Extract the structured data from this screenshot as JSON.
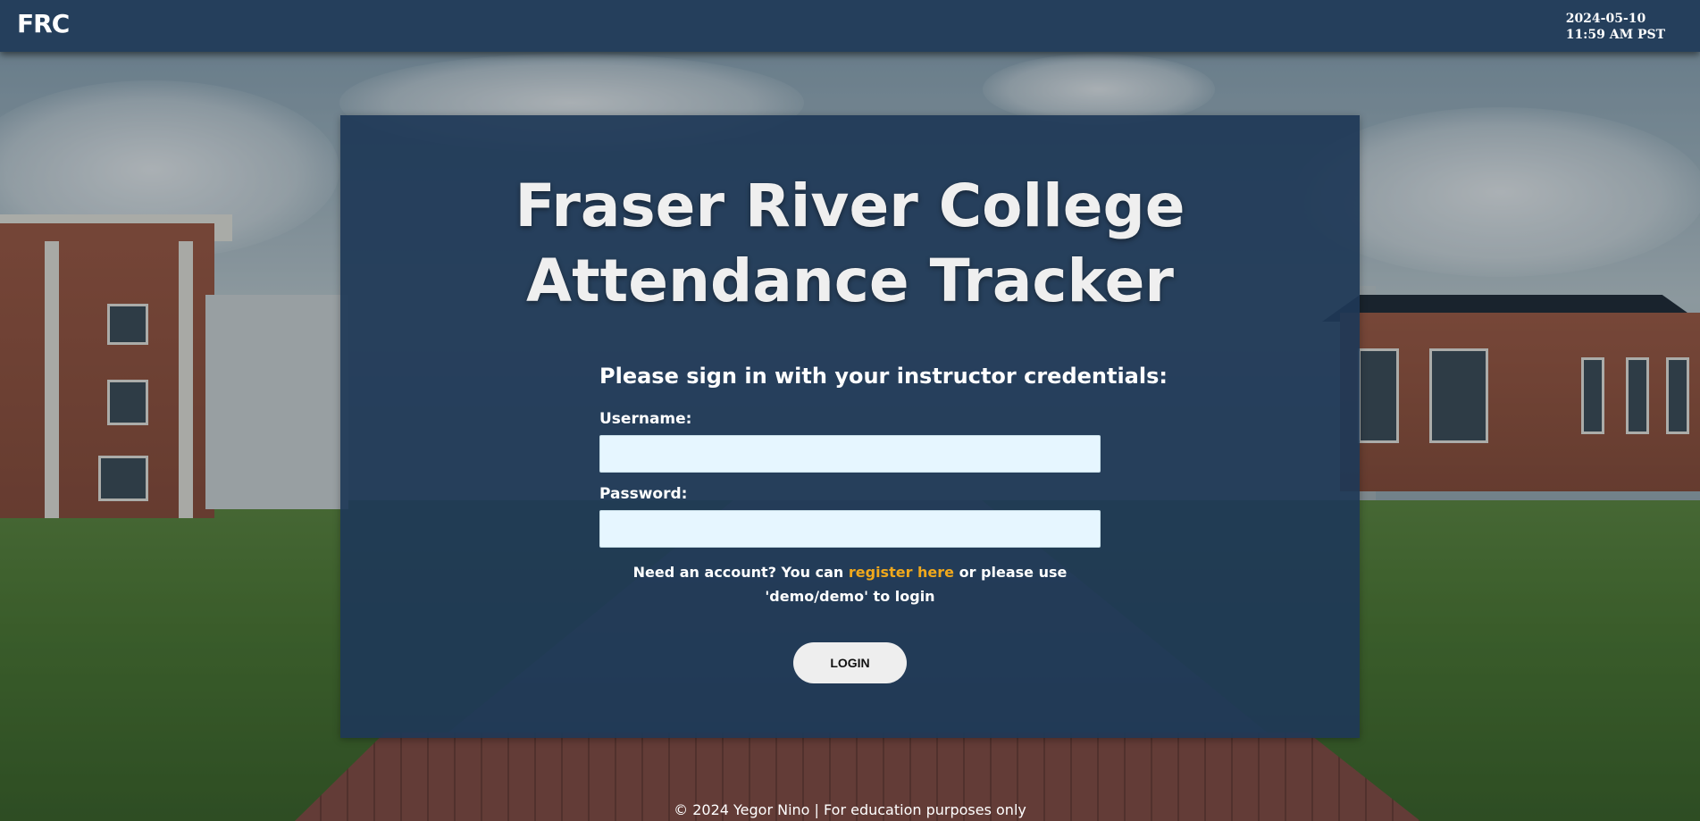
{
  "header": {
    "logo": "FRC",
    "date": "2024-05-10",
    "time": "11:59 AM PST"
  },
  "login": {
    "title_line1": "Fraser River College",
    "title_line2": "Attendance Tracker",
    "prompt": "Please sign in with your instructor credentials:",
    "username_label": "Username:",
    "username_value": "",
    "password_label": "Password:",
    "password_value": "",
    "note_before": "Need an account? You can ",
    "register_link": "register here",
    "note_after": " or please use 'demo/demo' to login",
    "button_label": "LOGIN"
  },
  "footer": {
    "text": "© 2024 Yegor Nino | For education purposes only"
  },
  "colors": {
    "topbar": "#253f5c",
    "card": "#1e3857",
    "link": "#f0a81c",
    "input_bg": "#e6f6ff",
    "button_bg": "#eeeeee"
  },
  "background": {
    "image": "campus-photo"
  }
}
